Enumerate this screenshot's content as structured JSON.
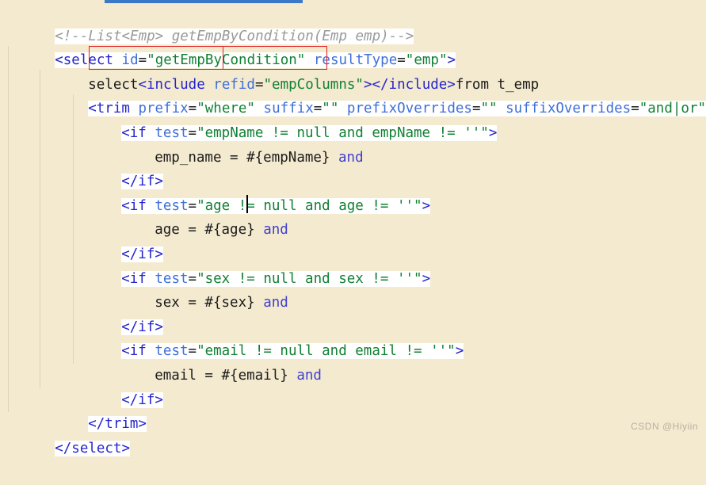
{
  "editor": {
    "watermark": "CSDN @Hiyiin",
    "colors": {
      "background": "#f4ead0",
      "highlight": "#ffffff",
      "tag": "#2525cc",
      "attribute": "#3f6fd8",
      "string": "#128033",
      "comment": "#9a9a9a",
      "plain": "#1b1b1b",
      "box": "#e02020",
      "topbar": "#3c78c8"
    },
    "lines": [
      {
        "id": "line-comment",
        "text": "<!--List<Emp> getEmpByCondition(Emp emp)-->",
        "indent": 0
      },
      {
        "id": "line-select-open",
        "text": "<select id=\"getEmpByCondition\" resultType=\"emp\">",
        "indent": 0
      },
      {
        "id": "line-select-include",
        "text": "select<include refid=\"empColumns\"></include>from t_emp",
        "indent": 1
      },
      {
        "id": "line-trim-open",
        "text": "<trim prefix=\"where\" suffix=\"\" prefixOverrides=\"\" suffixOverrides=\"and|or\">",
        "indent": 1
      },
      {
        "id": "line-if-empname",
        "text": "<if test=\"empName != null and empName != ''\">",
        "indent": 2
      },
      {
        "id": "line-body-empname",
        "text": "emp_name = #{empName} and",
        "indent": 3
      },
      {
        "id": "line-endif-empname",
        "text": "</if>",
        "indent": 2
      },
      {
        "id": "line-if-age",
        "text": "<if test=\"age != null and age != ''\">",
        "indent": 2
      },
      {
        "id": "line-body-age",
        "text": "age = #{age} and",
        "indent": 3
      },
      {
        "id": "line-endif-age",
        "text": "</if>",
        "indent": 2
      },
      {
        "id": "line-if-sex",
        "text": "<if test=\"sex != null and sex != ''\">",
        "indent": 2
      },
      {
        "id": "line-body-sex",
        "text": "sex = #{sex} and",
        "indent": 3
      },
      {
        "id": "line-endif-sex",
        "text": "</if>",
        "indent": 2
      },
      {
        "id": "line-if-email",
        "text": "<if test=\"email != null and email != ''\">",
        "indent": 2
      },
      {
        "id": "line-body-email",
        "text": "email = #{email} and",
        "indent": 3
      },
      {
        "id": "line-endif-email",
        "text": "</if>",
        "indent": 2
      },
      {
        "id": "line-trim-close",
        "text": "</trim>",
        "indent": 1
      },
      {
        "id": "line-select-close",
        "text": "</select>",
        "indent": 0
      }
    ],
    "annotations": {
      "include_box_label": "include-element-box",
      "refid_box_label": "refid-value-box",
      "refid_value": "\"empColumns\""
    }
  }
}
